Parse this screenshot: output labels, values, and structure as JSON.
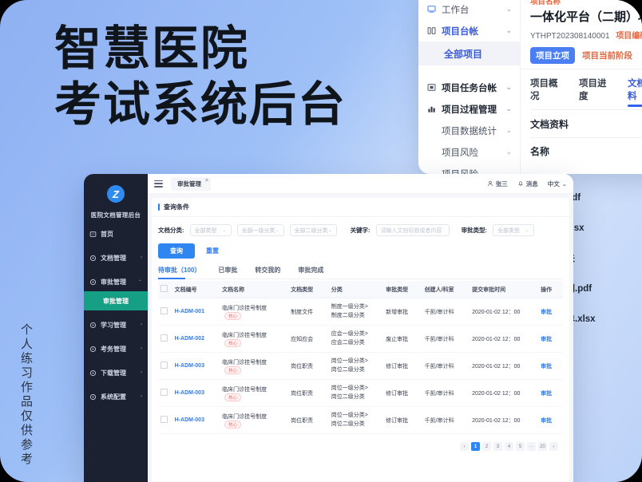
{
  "poster": {
    "headline_line1": "智慧医院",
    "headline_line2": "考试系统后台",
    "vertical_note": "个人练习作品仅供参考",
    "bg_accent": "#8fb0f2"
  },
  "project_card": {
    "sidebar": [
      {
        "label": "工作台",
        "icon": "monitor-icon",
        "chevron": "⌄",
        "style": "plain"
      },
      {
        "label": "项目台帐",
        "icon": "grid-icon",
        "chevron": "⌄",
        "style": "accent"
      },
      {
        "label": "全部项目",
        "icon": "",
        "chevron": "",
        "style": "sub"
      },
      {
        "label": "项目任务台帐",
        "icon": "board-icon",
        "chevron": "⌄",
        "style": "bold"
      },
      {
        "label": "项目过程管理",
        "icon": "bar-chart-icon",
        "chevron": "⌄",
        "style": "bold"
      },
      {
        "label": "项目数据统计",
        "icon": "",
        "chevron": "⌄",
        "style": "plain"
      },
      {
        "label": "项目风险",
        "icon": "",
        "chevron": "⌄",
        "style": "plain"
      },
      {
        "label": "项目风险",
        "icon": "",
        "chevron": "⌄",
        "style": "plain"
      }
    ],
    "header": {
      "name_label": "项目名称",
      "project_name": "一体化平台（二期）项目",
      "project_code": "YTHPT202308140001",
      "code_label": "项目编码",
      "stage_badge": "项目立项",
      "stage_label": "项目当前阶段"
    },
    "tabs": [
      {
        "label": "项目概况",
        "active": false
      },
      {
        "label": "项目进度",
        "active": false
      },
      {
        "label": "文档资料",
        "active": true
      }
    ],
    "section_title": "文档资料",
    "column_title": "名称"
  },
  "file_list": [
    {
      "name": "XXX合同.pdf",
      "indent": false
    },
    {
      "name": "功能清单.xlsx",
      "indent": false
    },
    {
      "name": "验收相关",
      "indent": true
    },
    {
      "name": "XXX合同.pdf",
      "indent": true
    },
    {
      "name": "功能清单.xlsx",
      "indent": true
    }
  ],
  "dashboard": {
    "sidebar": {
      "logo_text": "Z",
      "app_name": "医院文档管理后台",
      "items": [
        {
          "label": "首页",
          "icon": "home-icon",
          "arrow": "",
          "state": "normal"
        },
        {
          "label": "文档管理",
          "icon": "doc-icon",
          "arrow": "›",
          "state": "normal"
        },
        {
          "label": "审批管理",
          "icon": "approve-icon",
          "arrow": "⌃",
          "state": "expanded"
        },
        {
          "label": "审批管理",
          "icon": "",
          "arrow": "",
          "state": "active-sub"
        },
        {
          "label": "学习管理",
          "icon": "study-icon",
          "arrow": "›",
          "state": "normal"
        },
        {
          "label": "考务管理",
          "icon": "exam-icon",
          "arrow": "›",
          "state": "normal"
        },
        {
          "label": "下载管理",
          "icon": "download-icon",
          "arrow": "›",
          "state": "normal"
        },
        {
          "label": "系统配置",
          "icon": "gear-icon",
          "arrow": "›",
          "state": "normal"
        }
      ]
    },
    "topbar": {
      "tab_label": "审批管理",
      "tab_close": "×",
      "user_name": "张三",
      "message_label": "消息",
      "lang_label": "中文",
      "lang_caret": "⌄"
    },
    "query": {
      "section_title": "查询条件",
      "doc_category_label": "文档分类:",
      "selects": [
        "全部类型",
        "全部一级分类",
        "全部二级分类"
      ],
      "keyword_label": "关键字:",
      "keyword_placeholder": "请输入文档标题或者内容",
      "approval_type_label": "审批类型:",
      "approval_type_value": "全部类型",
      "search_button": "查询",
      "reset_button": "重置"
    },
    "tabs": [
      {
        "label": "待审批（100）",
        "active": true
      },
      {
        "label": "已审批",
        "active": false
      },
      {
        "label": "转交我的",
        "active": false
      },
      {
        "label": "审批完成",
        "active": false
      }
    ],
    "table": {
      "columns": [
        "",
        "文档编号",
        "文档名称",
        "文档类型",
        "分类",
        "审批类型",
        "创建人/科室",
        "提交审批时间",
        "操作"
      ],
      "rows": [
        {
          "code": "H-ADM-001",
          "name": "临床门诊挂号制度",
          "tag": "核心",
          "type": "制度文件",
          "cat1": "制度一级分类>",
          "cat2": "制度二级分类",
          "approval": "新增审批",
          "creator": "千凯/审计科",
          "time": "2020-01-02 12：00",
          "op": "审批"
        },
        {
          "code": "H-ADM-002",
          "name": "临床门诊挂号制度",
          "tag": "核心",
          "type": "应知应会",
          "cat1": "应会一级分类>",
          "cat2": "应会二级分类",
          "approval": "废止审批",
          "creator": "千凯/审计科",
          "time": "2020-01-02 12：00",
          "op": "审批"
        },
        {
          "code": "H-ADM-003",
          "name": "临床门诊挂号制度",
          "tag": "核心",
          "type": "岗位职责",
          "cat1": "岗位一级分类>",
          "cat2": "岗位二级分类",
          "approval": "修订审批",
          "creator": "千凯/审计科",
          "time": "2020-01-02 12：00",
          "op": "审批"
        },
        {
          "code": "H-ADM-003",
          "name": "临床门诊挂号制度",
          "tag": "核心",
          "type": "岗位职责",
          "cat1": "岗位一级分类>",
          "cat2": "岗位二级分类",
          "approval": "修订审批",
          "creator": "千凯/审计科",
          "time": "2020-01-02 12：00",
          "op": "审批"
        },
        {
          "code": "H-ADM-003",
          "name": "临床门诊挂号制度",
          "tag": "核心",
          "type": "岗位职责",
          "cat1": "岗位一级分类>",
          "cat2": "岗位二级分类",
          "approval": "修订审批",
          "creator": "千凯/审计科",
          "time": "2020-01-02 12：00",
          "op": "审批"
        }
      ]
    },
    "pagination": {
      "prev": "‹",
      "pages": [
        "1",
        "2",
        "3",
        "4",
        "5",
        "···",
        "20"
      ],
      "active_page": "1",
      "next": "›"
    }
  }
}
